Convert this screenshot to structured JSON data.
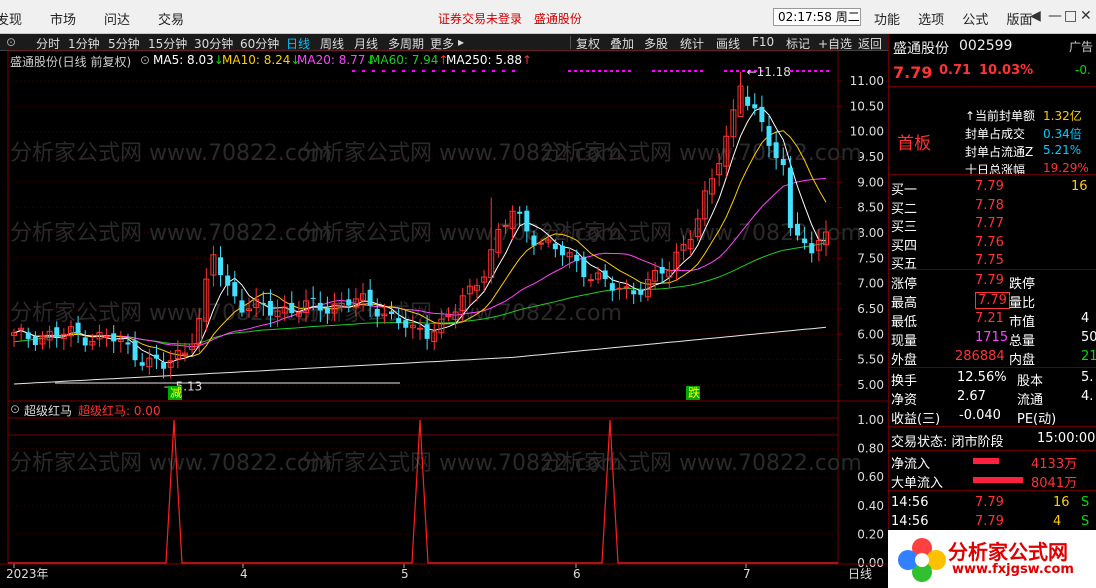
{
  "topbar": {
    "menus": [
      "发现",
      "市场",
      "问达",
      "交易"
    ],
    "notice": "证券交易未登录",
    "stock_name": "盛通股份",
    "clock": "02:17:58 周二",
    "right_menus": [
      "功能",
      "选项",
      "公式",
      "版面"
    ],
    "win_controls": [
      "◀",
      "—",
      "□",
      "✕"
    ]
  },
  "toolbar": {
    "periods": [
      "分时",
      "1分钟",
      "5分钟",
      "15分钟",
      "30分钟",
      "60分钟",
      "日线",
      "周线",
      "月线",
      "多周期",
      "更多"
    ],
    "active": "日线",
    "tools": [
      "复权",
      "叠加",
      "多股",
      "统计",
      "画线",
      "F10",
      "标记",
      "+自选",
      "返回"
    ]
  },
  "main_chart": {
    "title": "盛通股份(日线 前复权)",
    "ma": [
      {
        "label": "MA5: 8.03",
        "arrow": "↓",
        "color": "#ffffff"
      },
      {
        "label": "MA10: 8.24",
        "arrow": "↓",
        "color": "#ffcc00"
      },
      {
        "label": "MA20: 8.77",
        "arrow": "↓",
        "color": "#ff44ff"
      },
      {
        "label": "MA60: 7.94",
        "arrow": "↑",
        "color": "#22cc22"
      },
      {
        "label": "MA250: 5.88",
        "arrow": "↑",
        "color": "#ffffff"
      }
    ],
    "y_ticks": [
      "11.00",
      "10.50",
      "10.00",
      "9.50",
      "9.00",
      "8.50",
      "8.00",
      "7.50",
      "7.00",
      "6.50",
      "6.00",
      "5.50",
      "5.00"
    ],
    "high_label": "11.18",
    "low_label": "5.13",
    "markers": [
      "减",
      "跌"
    ],
    "watermark": "分析家公式网 www.70822.com"
  },
  "indicator": {
    "title": "超级红马",
    "value_label": "超级红马: 0.00",
    "y_ticks": [
      "1.00",
      "0.80",
      "0.60",
      "0.40",
      "0.20",
      "0.00"
    ]
  },
  "x_axis": {
    "labels": [
      "2023年",
      "4",
      "5",
      "6",
      "7"
    ],
    "period": "日线"
  },
  "quote": {
    "name": "盛通股份",
    "code": "002599",
    "price": "7.79",
    "change": "0.71",
    "pct": "10.03%",
    "status": "首板",
    "seal_rows": [
      {
        "label": "当前封单额",
        "value": "1.32亿"
      },
      {
        "label": "封单占成交",
        "value": "0.34倍"
      },
      {
        "label": "封单占流通Z",
        "value": "5.21%"
      },
      {
        "label": "十日总涨幅",
        "value": "19.29%"
      }
    ],
    "buy": [
      {
        "label": "买一",
        "price": "7.79",
        "vol": "16"
      },
      {
        "label": "买二",
        "price": "7.78",
        "vol": ""
      },
      {
        "label": "买三",
        "price": "7.77",
        "vol": ""
      },
      {
        "label": "买四",
        "price": "7.76",
        "vol": ""
      },
      {
        "label": "买五",
        "price": "7.75",
        "vol": ""
      }
    ],
    "stats": [
      {
        "l1": "涨停",
        "v1": "7.79",
        "l2": "跌停",
        "v2": ""
      },
      {
        "l1": "最高",
        "v1": "7.79",
        "l2": "量比",
        "v2": ""
      },
      {
        "l1": "最低",
        "v1": "7.21",
        "l2": "市值",
        "v2": "4"
      },
      {
        "l1": "现量",
        "v1": "1715",
        "l2": "总量",
        "v2": "50"
      },
      {
        "l1": "外盘",
        "v1": "286884",
        "l2": "内盘",
        "v2": "21"
      }
    ],
    "stats2": [
      {
        "l1": "换手",
        "v1": "12.56%",
        "l2": "股本",
        "v2": "5."
      },
      {
        "l1": "净资",
        "v1": "2.67",
        "l2": "流通",
        "v2": "4."
      },
      {
        "l1": "收益(三)",
        "v1": "-0.040",
        "l2": "PE(动)",
        "v2": ""
      }
    ],
    "trade_status": "交易状态: 闭市阶段",
    "trade_time": "15:00:00",
    "flows": [
      {
        "label": "净流入",
        "value": "4133万"
      },
      {
        "label": "大单流入",
        "value": "8041万"
      }
    ],
    "ticks": [
      {
        "time": "14:56",
        "price": "7.79",
        "vol": "16",
        "side": "S"
      },
      {
        "time": "14:56",
        "price": "7.79",
        "vol": "4",
        "side": "S"
      }
    ],
    "ad_label": "广告",
    "ad_value": "-0.",
    "logo_text": "分析家公式网",
    "logo_url": "www.fxjgsw.com"
  }
}
